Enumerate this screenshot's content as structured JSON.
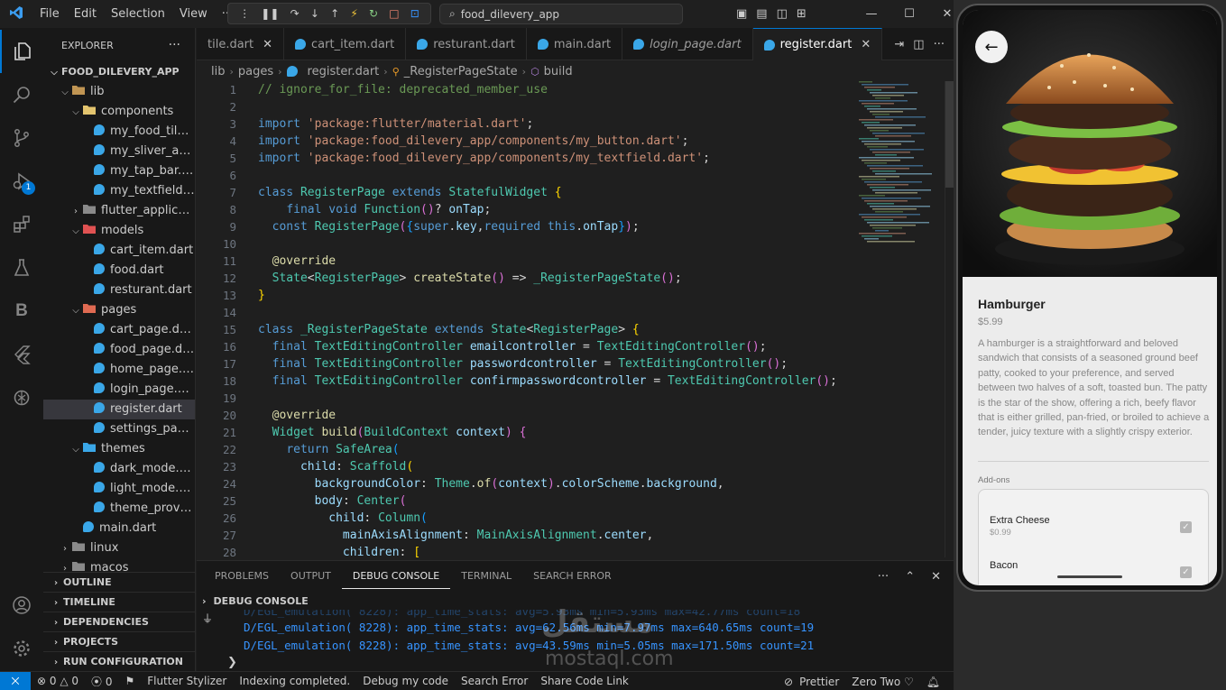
{
  "app": {
    "menu": [
      "File",
      "Edit",
      "Selection",
      "View",
      "···"
    ],
    "search_text": "food_dilevery_app"
  },
  "sidebar": {
    "title": "EXPLORER",
    "more": "···",
    "root": "FOOD_DILEVERY_APP",
    "tree": [
      {
        "label": "lib",
        "depth": 1,
        "type": "folder-open",
        "color": "#c09553"
      },
      {
        "label": "components",
        "depth": 2,
        "type": "folder-open",
        "color": "#e3c46e"
      },
      {
        "label": "my_food_tile.d...",
        "depth": 3,
        "type": "dart"
      },
      {
        "label": "my_sliver_app_...",
        "depth": 3,
        "type": "dart"
      },
      {
        "label": "my_tap_bar.dart",
        "depth": 3,
        "type": "dart"
      },
      {
        "label": "my_textfield.dart",
        "depth": 3,
        "type": "dart"
      },
      {
        "label": "flutter_applicati...",
        "depth": 2,
        "type": "folder-closed",
        "color": "#8a8a8a"
      },
      {
        "label": "models",
        "depth": 2,
        "type": "folder-open",
        "color": "#e05252"
      },
      {
        "label": "cart_item.dart",
        "depth": 3,
        "type": "dart"
      },
      {
        "label": "food.dart",
        "depth": 3,
        "type": "dart"
      },
      {
        "label": "resturant.dart",
        "depth": 3,
        "type": "dart"
      },
      {
        "label": "pages",
        "depth": 2,
        "type": "folder-open",
        "color": "#e06a52"
      },
      {
        "label": "cart_page.dart",
        "depth": 3,
        "type": "dart"
      },
      {
        "label": "food_page.dart",
        "depth": 3,
        "type": "dart"
      },
      {
        "label": "home_page.dart",
        "depth": 3,
        "type": "dart"
      },
      {
        "label": "login_page.dart",
        "depth": 3,
        "type": "dart"
      },
      {
        "label": "register.dart",
        "depth": 3,
        "type": "dart",
        "selected": true
      },
      {
        "label": "settings_page....",
        "depth": 3,
        "type": "dart"
      },
      {
        "label": "themes",
        "depth": 2,
        "type": "folder-open",
        "color": "#3aa7e8"
      },
      {
        "label": "dark_mode.dart",
        "depth": 3,
        "type": "dart"
      },
      {
        "label": "light_mode.dart",
        "depth": 3,
        "type": "dart"
      },
      {
        "label": "theme_provide...",
        "depth": 3,
        "type": "dart"
      },
      {
        "label": "main.dart",
        "depth": 2,
        "type": "dart"
      },
      {
        "label": "linux",
        "depth": 1,
        "type": "folder-closed",
        "color": "#8a8a8a"
      },
      {
        "label": "macos",
        "depth": 1,
        "type": "folder-closed",
        "color": "#8a8a8a"
      }
    ],
    "sections": [
      "OUTLINE",
      "TIMELINE",
      "DEPENDENCIES",
      "PROJECTS",
      "RUN CONFIGURATION"
    ]
  },
  "tabs": [
    {
      "label": "tile.dart",
      "close": "✕"
    },
    {
      "label": "cart_item.dart"
    },
    {
      "label": "resturant.dart"
    },
    {
      "label": "main.dart"
    },
    {
      "label": "login_page.dart",
      "italic": true
    },
    {
      "label": "register.dart",
      "active": true,
      "close": "✕"
    }
  ],
  "breadcrumb": [
    "lib",
    "pages",
    "register.dart",
    "_RegisterPageState",
    "build"
  ],
  "editor": {
    "line_numbers": [
      "1",
      "2",
      "3",
      "4",
      "5",
      "6",
      "7",
      "8",
      "9",
      "10",
      "11",
      "12",
      "13",
      "14",
      "15",
      "16",
      "17",
      "18",
      "19",
      "20",
      "21",
      "22",
      "23",
      "24",
      "25",
      "26",
      "27",
      "28"
    ],
    "lines": [
      [
        [
          "cmt",
          "// ignore_for_file: deprecated_member_use"
        ]
      ],
      [],
      [
        [
          "kw",
          "import"
        ],
        [
          "pn",
          " "
        ],
        [
          "str",
          "'package:flutter/material.dart'"
        ],
        [
          "pn",
          ";"
        ]
      ],
      [
        [
          "kw",
          "import"
        ],
        [
          "pn",
          " "
        ],
        [
          "str",
          "'package:food_dilevery_app/components/my_button.dart'"
        ],
        [
          "pn",
          ";"
        ]
      ],
      [
        [
          "kw",
          "import"
        ],
        [
          "pn",
          " "
        ],
        [
          "str",
          "'package:food_dilevery_app/components/my_textfield.dart'"
        ],
        [
          "pn",
          ";"
        ]
      ],
      [],
      [
        [
          "kw",
          "class"
        ],
        [
          "pn",
          " "
        ],
        [
          "cls",
          "RegisterPage"
        ],
        [
          "pn",
          " "
        ],
        [
          "kw",
          "extends"
        ],
        [
          "pn",
          " "
        ],
        [
          "cls",
          "StatefulWidget"
        ],
        [
          "pn",
          " "
        ],
        [
          "br",
          "{"
        ]
      ],
      [
        [
          "pn",
          "    "
        ],
        [
          "kw",
          "final"
        ],
        [
          "pn",
          " "
        ],
        [
          "kw",
          "void"
        ],
        [
          "pn",
          " "
        ],
        [
          "cls",
          "Function"
        ],
        [
          "br2",
          "()"
        ],
        [
          "pn",
          "? "
        ],
        [
          "var",
          "onTap"
        ],
        [
          "pn",
          ";"
        ]
      ],
      [
        [
          "pn",
          "  "
        ],
        [
          "kw",
          "const"
        ],
        [
          "pn",
          " "
        ],
        [
          "cls",
          "RegisterPage"
        ],
        [
          "br2",
          "("
        ],
        [
          "br3",
          "{"
        ],
        [
          "kw",
          "super"
        ],
        [
          "pn",
          "."
        ],
        [
          "var",
          "key"
        ],
        [
          "pn",
          ","
        ],
        [
          "kw",
          "required"
        ],
        [
          "pn",
          " "
        ],
        [
          "kw",
          "this"
        ],
        [
          "pn",
          "."
        ],
        [
          "var",
          "onTap"
        ],
        [
          "br3",
          "}"
        ],
        [
          "br2",
          ")"
        ],
        [
          "pn",
          ";"
        ]
      ],
      [],
      [
        [
          "pn",
          "  "
        ],
        [
          "ann",
          "@override"
        ]
      ],
      [
        [
          "pn",
          "  "
        ],
        [
          "cls",
          "State"
        ],
        [
          "pn",
          "<"
        ],
        [
          "cls",
          "RegisterPage"
        ],
        [
          "pn",
          "> "
        ],
        [
          "fn",
          "createState"
        ],
        [
          "br2",
          "()"
        ],
        [
          "pn",
          " => "
        ],
        [
          "cls",
          "_RegisterPageState"
        ],
        [
          "br2",
          "()"
        ],
        [
          "pn",
          ";"
        ]
      ],
      [
        [
          "br",
          "}"
        ]
      ],
      [],
      [
        [
          "kw",
          "class"
        ],
        [
          "pn",
          " "
        ],
        [
          "cls",
          "_RegisterPageState"
        ],
        [
          "pn",
          " "
        ],
        [
          "kw",
          "extends"
        ],
        [
          "pn",
          " "
        ],
        [
          "cls",
          "State"
        ],
        [
          "pn",
          "<"
        ],
        [
          "cls",
          "RegisterPage"
        ],
        [
          "pn",
          "> "
        ],
        [
          "br",
          "{"
        ]
      ],
      [
        [
          "pn",
          "  "
        ],
        [
          "kw",
          "final"
        ],
        [
          "pn",
          " "
        ],
        [
          "cls",
          "TextEditingController"
        ],
        [
          "pn",
          " "
        ],
        [
          "var",
          "emailcontroller"
        ],
        [
          "pn",
          " = "
        ],
        [
          "cls",
          "TextEditingController"
        ],
        [
          "br2",
          "()"
        ],
        [
          "pn",
          ";"
        ]
      ],
      [
        [
          "pn",
          "  "
        ],
        [
          "kw",
          "final"
        ],
        [
          "pn",
          " "
        ],
        [
          "cls",
          "TextEditingController"
        ],
        [
          "pn",
          " "
        ],
        [
          "var",
          "passwordcontroller"
        ],
        [
          "pn",
          " = "
        ],
        [
          "cls",
          "TextEditingController"
        ],
        [
          "br2",
          "()"
        ],
        [
          "pn",
          ";"
        ]
      ],
      [
        [
          "pn",
          "  "
        ],
        [
          "kw",
          "final"
        ],
        [
          "pn",
          " "
        ],
        [
          "cls",
          "TextEditingController"
        ],
        [
          "pn",
          " "
        ],
        [
          "var",
          "confirmpasswordcontroller"
        ],
        [
          "pn",
          " = "
        ],
        [
          "cls",
          "TextEditingController"
        ],
        [
          "br2",
          "()"
        ],
        [
          "pn",
          ";"
        ]
      ],
      [],
      [
        [
          "pn",
          "  "
        ],
        [
          "ann",
          "@override"
        ]
      ],
      [
        [
          "pn",
          "  "
        ],
        [
          "cls",
          "Widget"
        ],
        [
          "pn",
          " "
        ],
        [
          "fn",
          "build"
        ],
        [
          "br2",
          "("
        ],
        [
          "cls",
          "BuildContext"
        ],
        [
          "pn",
          " "
        ],
        [
          "var",
          "context"
        ],
        [
          "br2",
          ")"
        ],
        [
          "pn",
          " "
        ],
        [
          "br2",
          "{"
        ]
      ],
      [
        [
          "pn",
          "    "
        ],
        [
          "kw",
          "return"
        ],
        [
          "pn",
          " "
        ],
        [
          "cls",
          "SafeArea"
        ],
        [
          "br3",
          "("
        ]
      ],
      [
        [
          "pn",
          "      "
        ],
        [
          "var",
          "child"
        ],
        [
          "pn",
          ": "
        ],
        [
          "cls",
          "Scaffold"
        ],
        [
          "br",
          "("
        ]
      ],
      [
        [
          "pn",
          "        "
        ],
        [
          "var",
          "backgroundColor"
        ],
        [
          "pn",
          ": "
        ],
        [
          "cls",
          "Theme"
        ],
        [
          "pn",
          "."
        ],
        [
          "fn",
          "of"
        ],
        [
          "br2",
          "("
        ],
        [
          "var",
          "context"
        ],
        [
          "br2",
          ")"
        ],
        [
          "pn",
          "."
        ],
        [
          "var",
          "colorScheme"
        ],
        [
          "pn",
          "."
        ],
        [
          "var",
          "background"
        ],
        [
          "pn",
          ","
        ]
      ],
      [
        [
          "pn",
          "        "
        ],
        [
          "var",
          "body"
        ],
        [
          "pn",
          ": "
        ],
        [
          "cls",
          "Center"
        ],
        [
          "br2",
          "("
        ]
      ],
      [
        [
          "pn",
          "          "
        ],
        [
          "var",
          "child"
        ],
        [
          "pn",
          ": "
        ],
        [
          "cls",
          "Column"
        ],
        [
          "br3",
          "("
        ]
      ],
      [
        [
          "pn",
          "            "
        ],
        [
          "var",
          "mainAxisAlignment"
        ],
        [
          "pn",
          ": "
        ],
        [
          "cls",
          "MainAxisAlignment"
        ],
        [
          "pn",
          "."
        ],
        [
          "var",
          "center"
        ],
        [
          "pn",
          ","
        ]
      ],
      [
        [
          "pn",
          "            "
        ],
        [
          "var",
          "children"
        ],
        [
          "pn",
          ": "
        ],
        [
          "br",
          "["
        ]
      ]
    ]
  },
  "panel": {
    "tabs": [
      "PROBLEMS",
      "OUTPUT",
      "DEBUG CONSOLE",
      "TERMINAL",
      "SEARCH ERROR"
    ],
    "active_tab": "DEBUG CONSOLE",
    "section_title": "DEBUG CONSOLE",
    "logs": [
      "D/EGL_emulation( 8228): app_time_stats: avg=62.56ms min=7.97ms max=640.65ms count=19",
      "D/EGL_emulation( 8228): app_time_stats: avg=43.59ms min=5.05ms max=171.50ms count=21"
    ],
    "faded_log": "D/EGL_emulation( 8228): app_time_stats: avg=5.93ms min=5.93ms max=42.77ms count=18",
    "prompt": "❯"
  },
  "statusbar": {
    "remote": "⨉",
    "problems": "⊗ 0 △ 0",
    "ports": "⦿ 0",
    "items_left": [
      "Flutter Stylizer",
      "Indexing completed.",
      "Debug my code",
      "Search Error",
      "Share Code Link"
    ],
    "items_right": [
      "Prettier",
      "Zero Two ♡"
    ]
  },
  "phone": {
    "food_name": "Hamburger",
    "food_price": "$5.99",
    "description": "A hamburger is a straightforward and beloved sandwich that consists of a seasoned ground beef patty, cooked to your preference, and served between two halves of a soft, toasted bun. The patty is the star of the show, offering a rich, beefy flavor that is either grilled, pan-fried, or broiled to achieve a tender, juicy texture with a slightly crispy exterior.",
    "addons_label": "Add-ons",
    "addons": [
      {
        "name": "Extra Cheese",
        "price": "$0.99",
        "checked": true
      },
      {
        "name": "Bacon",
        "price": "",
        "checked": true
      }
    ]
  },
  "watermark": {
    "arabic": "مستقل",
    "latin": "mostaql.com"
  },
  "colors": {
    "accent": "#0078d4",
    "log_blue": "#3794ff",
    "dart_blue": "#3aa7e8"
  }
}
